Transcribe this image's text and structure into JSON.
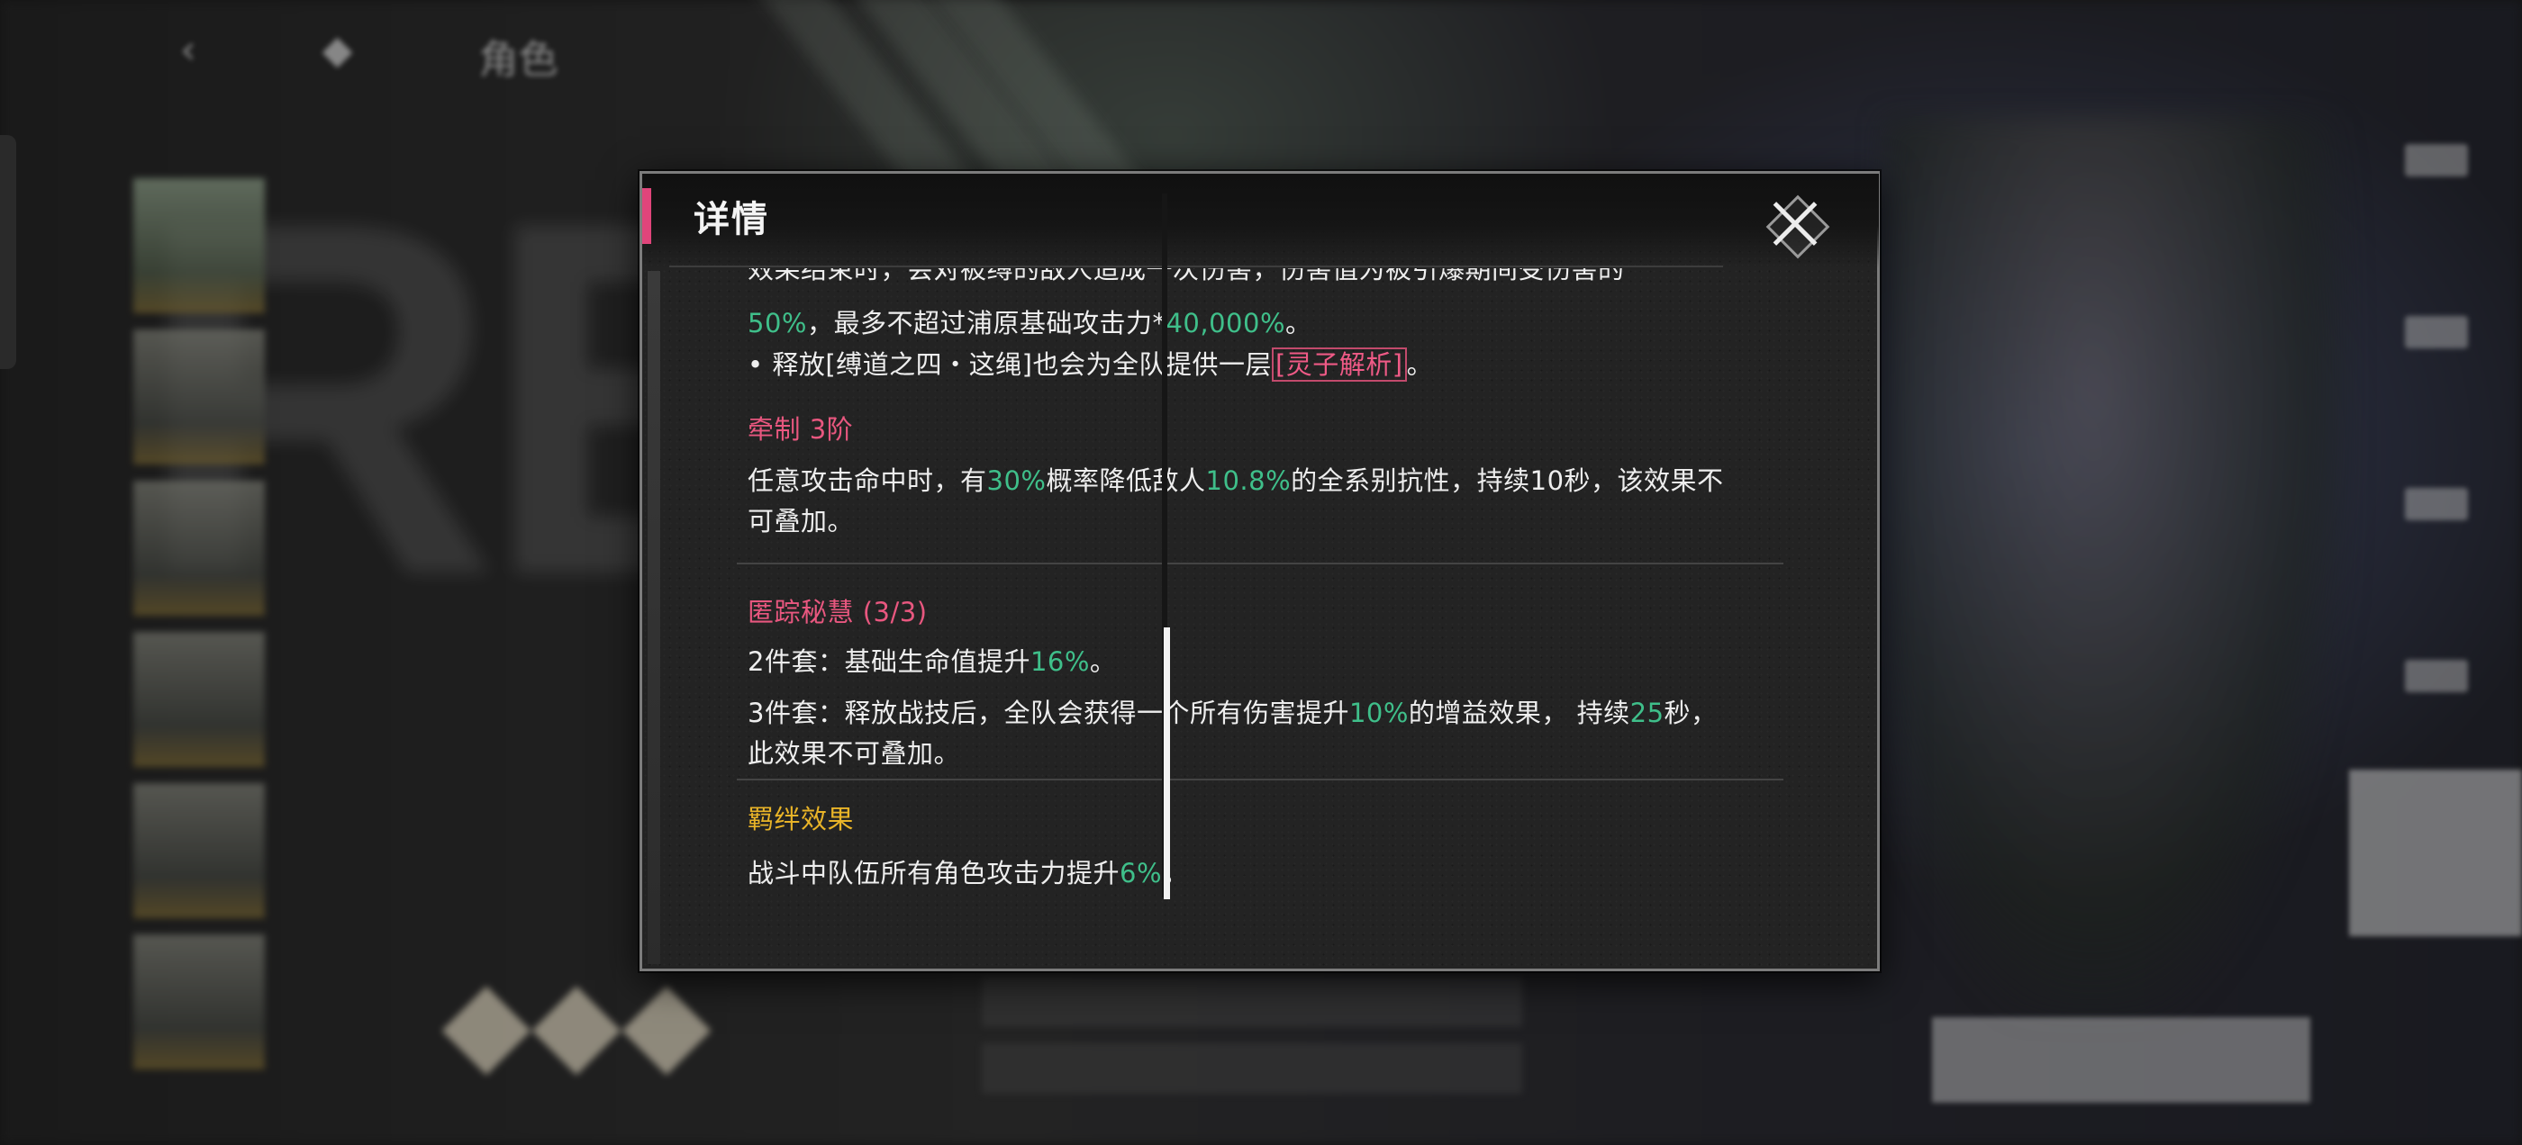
{
  "background": {
    "nav_left": "‹",
    "nav_mid": "◆",
    "nav_right": "角色"
  },
  "dialog": {
    "title": "详情",
    "close_icon": "close-x-icon",
    "accent_color": "#e0457b"
  },
  "passive": {
    "line0": "效果结束时，会对被缚的敌人造成一次伤害，伤害值为被引爆期间受伤害的",
    "line1_val": "50%",
    "line1_text": "，最多不超过浦原基础攻击力*",
    "line1_val2": "40,000%",
    "line1_end": "。",
    "bullet_pre": "• 释放[缚道之四・这绳]也会为全队提供一层",
    "bullet_link": "[灵子解析]",
    "bullet_end": "。"
  },
  "restraint": {
    "title": "牵制 3阶",
    "p1_a": "任意攻击命中时，有",
    "p1_v1": "30%",
    "p1_b": "概率降低敌人",
    "p1_v2": "10.8%",
    "p1_c": "的全系别抗性，持续10秒，该效果不",
    "p2": "可叠加。"
  },
  "set_bonus": {
    "title": "匿踪秘慧 (3/3)",
    "two_a": "2件套：基础生命值提升",
    "two_v": "16%",
    "two_end": "。",
    "three_a": "3件套：释放战技后，全队会获得一个所有伤害提升",
    "three_v1": "10%",
    "three_b": "的增益效果， 持续",
    "three_v2": "25",
    "three_c": "秒，",
    "three_d": "此效果不可叠加。"
  },
  "bond": {
    "title": "羁绊效果",
    "text_a": "战斗中队伍所有角色攻击力提升",
    "text_v": "6%",
    "text_end": "。"
  },
  "colors": {
    "highlight_green": "#3fbf8a",
    "section_pink": "#e8577f",
    "bond_yellow": "#e9b428"
  }
}
